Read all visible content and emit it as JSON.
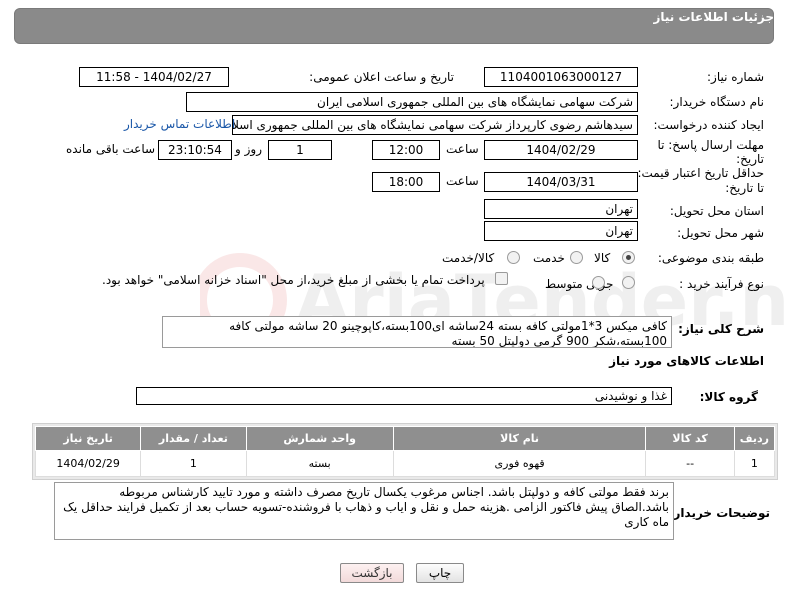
{
  "header": {
    "title": "جزئیات اطلاعات نیاز"
  },
  "fields": {
    "need_number_label": "شماره نیاز:",
    "need_number": "1104001063000127",
    "announce_label": "تاریخ و ساعت اعلان عمومی:",
    "announce_value": "1404/02/27 - 11:58",
    "buyer_org_label": "نام دستگاه خریدار:",
    "buyer_org": "شرکت سهامی نمایشگاه های بین المللی جمهوری اسلامی ایران",
    "creator_label": "ایجاد کننده درخواست:",
    "creator": "سیدهاشم رضوی کارپرداز شرکت سهامی نمایشگاه های بین المللی جمهوری اسلامی ایران",
    "contact_link": "اطلاعات تماس خریدار",
    "deadline_label_1": "مهلت ارسال پاسخ: تا",
    "deadline_label_2": "تاریخ:",
    "deadline_date": "1404/02/29",
    "time_label": "ساعت",
    "deadline_time": "12:00",
    "days_value": "1",
    "days_label": "روز و",
    "remaining_time": "23:10:54",
    "remaining_label": "ساعت باقی مانده",
    "validity_label_1": "حداقل تاریخ اعتبار قیمت:",
    "validity_label_2": "تا تاریخ:",
    "validity_date": "1404/03/31",
    "validity_time": "18:00",
    "province_label": "استان محل تحویل:",
    "province": "تهران",
    "city_label": "شهر محل تحویل:",
    "city": "تهران",
    "category_label": "طبقه بندی موضوعی:",
    "category_options": [
      "کالا",
      "خدمت",
      "کالا/خدمت"
    ],
    "category_selected": "کالا",
    "process_label": "نوع فرآیند خرید :",
    "process_options": [
      "جزیی",
      "متوسط"
    ],
    "payment_note": "پرداخت تمام یا بخشی از مبلغ خرید،از محل \"اسناد خزانه اسلامی\" خواهد بود."
  },
  "description": {
    "label": "شرح کلی نیاز:",
    "text": "کافی میکس 3*1مولتی کافه بسته 24ساشه ای100بسته،کاپوچینو 20 ساشه مولتی کافه 100بسته،شکر 900 گرمی دولپتل 50 بسته"
  },
  "goods_info_title": "اطلاعات کالاهای مورد نیاز",
  "goods_group": {
    "label": "گروه کالا:",
    "value": "غذا و نوشیدنی"
  },
  "items_table": {
    "headers": [
      "ردیف",
      "کد کالا",
      "نام کالا",
      "واحد شمارش",
      "تعداد / مقدار",
      "تاریخ نیاز"
    ],
    "rows": [
      [
        "1",
        "--",
        "قهوه فوری",
        "بسته",
        "1",
        "1404/02/29"
      ]
    ]
  },
  "buyer_notes": {
    "label": "توضیحات خریدار:",
    "text": "برند فقط مولتی کافه و دولپتل باشد. اجناس مرغوب یکسال تاریخ مصرف داشته و مورد تایید کارشناس  مربوطه باشد.الصاق پیش فاکتور الزامی .هزینه حمل و نقل و ایاب و ذهاب با فروشنده-تسویه حساب بعد از تکمیل فرایند حداقل یک ماه کاری"
  },
  "buttons": {
    "print": "چاپ",
    "back": "بازگشت"
  },
  "watermark": "AriaTender.neT"
}
